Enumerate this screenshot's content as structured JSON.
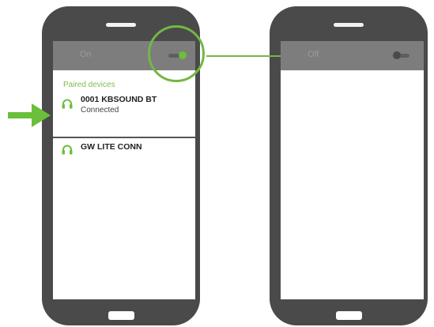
{
  "left_phone": {
    "status": "On",
    "bluetooth_on": true,
    "paired_header": "Paired devices",
    "devices": [
      {
        "name": "0001 KBSOUND BT",
        "status": "Connected",
        "icon": "headphones-icon"
      },
      {
        "name": "GW LITE CONN",
        "status": "",
        "icon": "headphones-icon"
      }
    ]
  },
  "right_phone": {
    "status": "Off",
    "bluetooth_on": false
  },
  "colors": {
    "accent": "#72b843",
    "phone_body": "#4a4a4a",
    "topbar": "#7d7d7d"
  }
}
